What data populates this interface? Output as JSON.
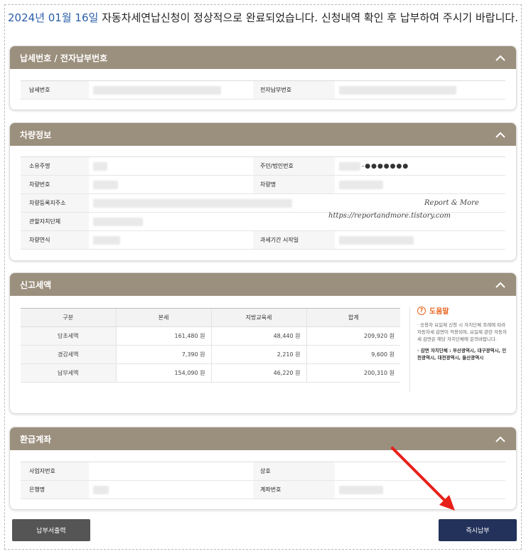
{
  "headline": {
    "date": "2024년 01월 16일",
    "message": " 자동차세연납신청이 정상적으로 완료되었습니다. 신청내역 확인 후 납부하여 주시기 바랍니다."
  },
  "panels": {
    "tax_number": {
      "title": "납세번호 / 전자납부번호",
      "rows": [
        {
          "k1": "납세번호",
          "k2": "전자납부번호"
        }
      ]
    },
    "vehicle": {
      "title": "차량정보",
      "rows": [
        {
          "k1": "소유주명",
          "k2": "주민/법인번호",
          "v2_suffix": "-●●●●●●●"
        },
        {
          "k1": "차량번호",
          "k2": "차량명"
        },
        {
          "k1": "차량등록지주소"
        },
        {
          "k1": "관할자치단체"
        },
        {
          "k1": "차량연식",
          "k2": "과세기간 시작일"
        }
      ]
    },
    "report_tax": {
      "title": "신고세액",
      "headers": [
        "구분",
        "본세",
        "지방교육세",
        "합계"
      ],
      "rows": [
        {
          "label": "당초세액",
          "base": "161,480 원",
          "edu": "48,440 원",
          "total": "209,920 원"
        },
        {
          "label": "경감세액",
          "base": "7,390 원",
          "edu": "2,210 원",
          "total": "9,600 원"
        },
        {
          "label": "납부세액",
          "base": "154,090 원",
          "edu": "46,220 원",
          "total": "200,310 원"
        }
      ],
      "help": {
        "icon": "?",
        "title": "도움말",
        "p1": "· 승용차 요일제 신청 시 자치단체 조례에 따라 자동차세 감면이 적용되며, 요일제 관련 자동차세 감면은 해당 자치단체에 문의바랍니다.",
        "p2": "· 감면 자치단체 : 부산광역시, 대구광역시, 인천광역시, 대전광역시, 울산광역시"
      }
    },
    "refund": {
      "title": "환급계좌",
      "rows": [
        {
          "k1": "사업자번호",
          "k2": "상호"
        },
        {
          "k1": "은행명",
          "k2": "계좌번호"
        }
      ]
    }
  },
  "watermark": {
    "line1": "Report & More",
    "line2": "https://reportandmore.tistory.com"
  },
  "buttons": {
    "print": "납부서출력",
    "pay": "즉시납부"
  },
  "colors": {
    "panel_header": "#9b8f7d",
    "print_button": "#555555",
    "pay_button": "#23325a",
    "arrow": "#e8201a",
    "date_text": "#2a5ea8"
  }
}
